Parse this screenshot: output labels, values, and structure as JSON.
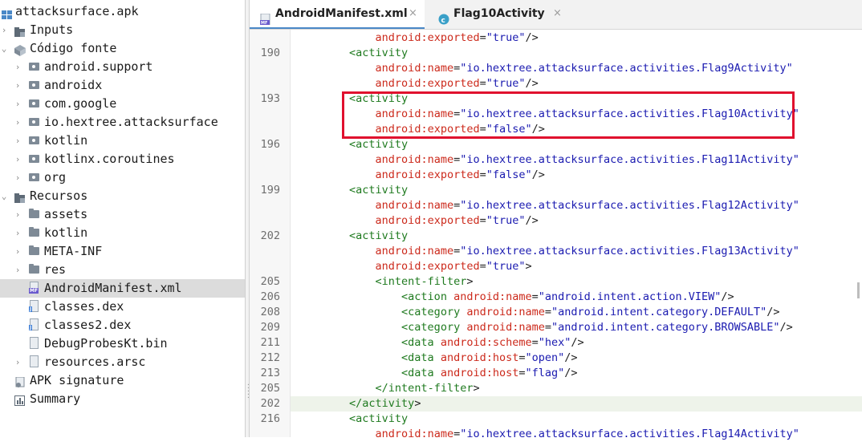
{
  "tree": {
    "items": [
      {
        "label": "attacksurface.apk",
        "icon": "project-icon",
        "arrow": ""
      },
      {
        "label": "Inputs",
        "icon": "inputs-folder-icon",
        "arrow": "›"
      },
      {
        "label": "Código fonte",
        "icon": "source-code-icon",
        "arrow": "⌄"
      },
      {
        "label": "android.support",
        "icon": "package-icon",
        "arrow": "›"
      },
      {
        "label": "androidx",
        "icon": "package-icon",
        "arrow": "›"
      },
      {
        "label": "com.google",
        "icon": "package-icon",
        "arrow": "›"
      },
      {
        "label": "io.hextree.attacksurface",
        "icon": "package-icon",
        "arrow": "›"
      },
      {
        "label": "kotlin",
        "icon": "package-icon",
        "arrow": "›"
      },
      {
        "label": "kotlinx.coroutines",
        "icon": "package-icon",
        "arrow": "›"
      },
      {
        "label": "org",
        "icon": "package-icon",
        "arrow": "›"
      },
      {
        "label": "Recursos",
        "icon": "resources-folder-icon",
        "arrow": "⌄"
      },
      {
        "label": "assets",
        "icon": "folder-icon",
        "arrow": "›"
      },
      {
        "label": "kotlin",
        "icon": "folder-icon",
        "arrow": "›"
      },
      {
        "label": "META-INF",
        "icon": "folder-icon",
        "arrow": "›"
      },
      {
        "label": "res",
        "icon": "folder-icon",
        "arrow": "›"
      },
      {
        "label": "AndroidManifest.xml",
        "icon": "manifest-file-icon",
        "arrow": ""
      },
      {
        "label": "classes.dex",
        "icon": "dex-file-icon",
        "arrow": ""
      },
      {
        "label": "classes2.dex",
        "icon": "dex-file-icon",
        "arrow": ""
      },
      {
        "label": "DebugProbesKt.bin",
        "icon": "binary-file-icon",
        "arrow": ""
      },
      {
        "label": "resources.arsc",
        "icon": "arsc-file-icon",
        "arrow": "›"
      },
      {
        "label": "APK signature",
        "icon": "signature-icon",
        "arrow": ""
      },
      {
        "label": "Summary",
        "icon": "summary-icon",
        "arrow": ""
      }
    ]
  },
  "tabs": [
    {
      "label": "AndroidManifest.xml",
      "icon": "manifest-tab-icon",
      "close": "×"
    },
    {
      "label": "Flag10Activity",
      "icon": "class-tab-icon",
      "close": "×"
    }
  ],
  "editor": {
    "line_numbers": [
      "190",
      "193",
      "196",
      "199",
      "202",
      "205",
      "206",
      "208",
      "209",
      "211",
      "212",
      "213",
      "205",
      "202",
      "216"
    ],
    "lines": [
      "            android:exported=\"true\"/>",
      "        <activity",
      "            android:name=\"io.hextree.attacksurface.activities.Flag9Activity\"",
      "            android:exported=\"true\"/>",
      "        <activity",
      "            android:name=\"io.hextree.attacksurface.activities.Flag10Activity\"",
      "            android:exported=\"false\"/>",
      "        <activity",
      "            android:name=\"io.hextree.attacksurface.activities.Flag11Activity\"",
      "            android:exported=\"false\"/>",
      "        <activity",
      "            android:name=\"io.hextree.attacksurface.activities.Flag12Activity\"",
      "            android:exported=\"true\"/>",
      "        <activity",
      "            android:name=\"io.hextree.attacksurface.activities.Flag13Activity\"",
      "            android:exported=\"true\">",
      "            <intent-filter>",
      "                <action android:name=\"android.intent.action.VIEW\"/>",
      "                <category android:name=\"android.intent.category.DEFAULT\"/>",
      "                <category android:name=\"android.intent.category.BROWSABLE\"/>",
      "                <data android:scheme=\"hex\"/>",
      "                <data android:host=\"open\"/>",
      "                <data android:host=\"flag\"/>",
      "            </intent-filter>",
      "        </activity>",
      "        <activity",
      "            android:name=\"io.hextree.attacksurface.activities.Flag14Activity\""
    ],
    "highlight_color": "#e0102e"
  }
}
